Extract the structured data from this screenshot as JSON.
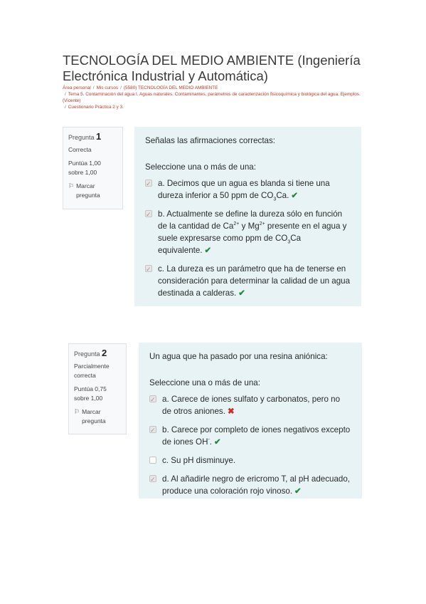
{
  "page": {
    "title": "TECNOLOGÍA DEL MEDIO AMBIENTE (Ingeniería Electrónica Industrial y Automática)"
  },
  "breadcrumb": {
    "items": [
      "Área personal",
      "Mis cursos",
      "(5580) TECNOLOGÍA DEL MEDIO AMBIENTE",
      "Tema 5. Contaminación del agua I. Aguas naturales. Contaminantes, parámetros de caracterización fisicoquímica y biológica del agua. Ejemplos. (Vicente)",
      "Cuestionario Práctica 2 y 3."
    ]
  },
  "questions": [
    {
      "label": "Pregunta",
      "number": "1",
      "state": "Correcta",
      "grade": "Puntúa 1,00 sobre 1,00",
      "flag": "Marcar pregunta",
      "text": "Señalas las afirmaciones correctas:",
      "prompt": "Seleccione una o más de una:",
      "answers": [
        {
          "prefix": "a. Decimos que un agua es blanda si tiene una dureza inferior a 50 ppm de CO",
          "sub": "3",
          "suffix": "Ca.",
          "checked": true,
          "result": "correct",
          "result_icon": "check-icon"
        },
        {
          "prefix": "b. Actualmente se define la dureza sólo en función de la cantidad de Ca",
          "sup1": "2+",
          "mid": " y Mg",
          "sup2": "2+",
          "mid2": " presente en el agua y suele expresarse como ppm de CO",
          "sub": "3",
          "suffix": "Ca equivalente.",
          "checked": true,
          "result": "correct",
          "result_icon": "check-icon"
        },
        {
          "text": "c. La dureza es un parámetro que ha de tenerse en consideración para determinar la calidad de un agua destinada a calderas.",
          "checked": true,
          "result": "correct",
          "result_icon": "check-icon"
        }
      ]
    },
    {
      "label": "Pregunta",
      "number": "2",
      "state": "Parcialmente correcta",
      "grade": "Puntúa 0,75 sobre 1,00",
      "flag": "Marcar pregunta",
      "text": "Un agua que ha pasado por una resina aniónica:",
      "prompt": "Seleccione una o más de una:",
      "answers": [
        {
          "text": "a. Carece de iones sulfato y carbonatos, pero no de otros aniones.",
          "checked": true,
          "result": "incorrect",
          "result_icon": "cross-icon"
        },
        {
          "prefix": "b. Carece por completo de iones negativos excepto de iones OH",
          "sup1": "-",
          "suffix": ".",
          "checked": true,
          "result": "correct",
          "result_icon": "check-icon"
        },
        {
          "text": "c. Su pH disminuye.",
          "checked": false
        },
        {
          "text": "d. Al añadirle negro de ericromo T, al pH adecuado, produce una coloración rojo vinoso.",
          "checked": true,
          "result": "correct",
          "result_icon": "check-icon"
        }
      ]
    }
  ],
  "colors": {
    "content_bg": "#e7f3f5",
    "correct": "#1e8a3a",
    "incorrect": "#c9302c",
    "breadcrumb_link": "#c0392b"
  }
}
